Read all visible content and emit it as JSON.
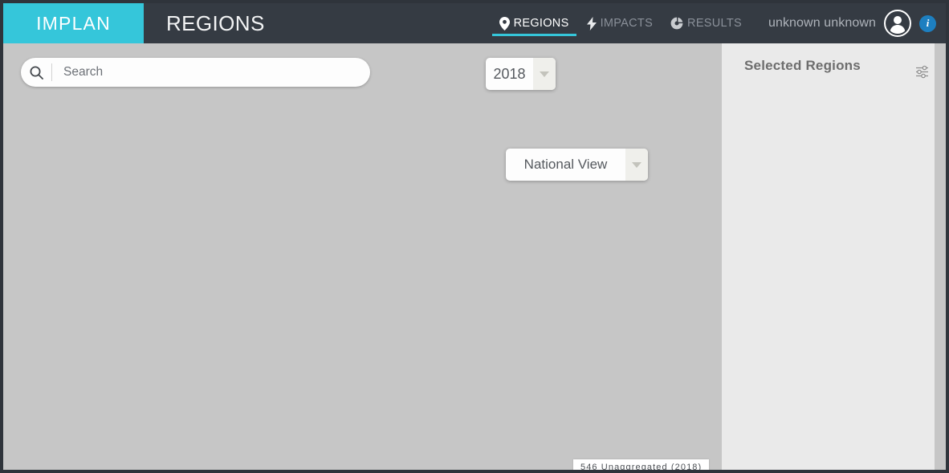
{
  "header": {
    "logo_text": "IMPLAN",
    "app_title": "REGIONS",
    "nav": [
      {
        "label": "REGIONS",
        "icon": "map-pin-icon",
        "active": true
      },
      {
        "label": "IMPACTS",
        "icon": "lightning-bolt-icon",
        "active": false
      },
      {
        "label": "RESULTS",
        "icon": "pie-chart-icon",
        "active": false
      }
    ],
    "user_name": "unknown unknown",
    "avatar_icon": "user-avatar-icon",
    "info_label": "i"
  },
  "map": {
    "search": {
      "placeholder": "Search",
      "value": "",
      "icon": "search-icon"
    },
    "year_dropdown": {
      "value": "2018",
      "icon": "chevron-down-icon"
    },
    "view_dropdown": {
      "value": "National View",
      "icon": "chevron-down-icon"
    },
    "status_badge": "546 Unaggregated (2018)"
  },
  "sidebar": {
    "title": "Selected Regions",
    "settings_icon": "sliders-icon",
    "items": []
  },
  "colors": {
    "brand_teal": "#35c6da",
    "header_dark": "#353b43",
    "map_grey": "#c6c6c6",
    "sidebar_grey": "#eaeaea",
    "info_blue": "#1d7fc0"
  }
}
